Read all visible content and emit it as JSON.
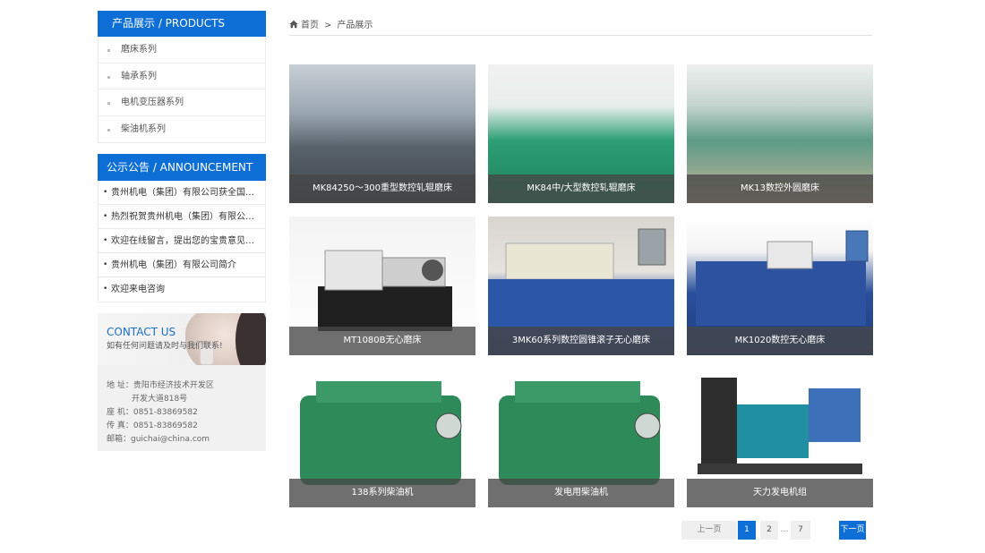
{
  "sidebar": {
    "products": {
      "title": "产品展示 / PRODUCTS",
      "items": [
        "磨床系列",
        "轴承系列",
        "电机变压器系列",
        "柴油机系列"
      ]
    },
    "announcement": {
      "title": "公示公告 / ANNOUNCEMENT",
      "items": [
        "贵州机电（集团）有限公司获全国…",
        "热烈祝贺贵州机电（集团）有限公…",
        "欢迎在线留言，提出您的宝贵意见…",
        "贵州机电（集团）有限公司简介",
        "欢迎来电咨询"
      ]
    },
    "contact": {
      "title": "CONTACT US",
      "subtitle": "如有任何问题请及时与我们联系!",
      "address_label": "地 址：",
      "address_line1": "贵阳市经济技术开发区",
      "address_line2": "开发大道818号",
      "phone_label": "座 机：",
      "phone": "0851-83869582",
      "fax_label": "传 真：",
      "fax": "0851-83869582",
      "email_label": "邮箱：",
      "email": "guichai@china.com"
    }
  },
  "breadcrumb": {
    "home": "首页",
    "separator": ">",
    "current": "产品展示"
  },
  "products": [
    {
      "caption": "MK84250～300重型数控轧辊磨床",
      "style": "ph-workshop"
    },
    {
      "caption": "MK84中/大型数控轧辊磨床",
      "style": "ph-green"
    },
    {
      "caption": "MK13数控外圆磨床",
      "style": "ph-greenlong"
    },
    {
      "caption": "MT1080B无心磨床",
      "style": "ph-white"
    },
    {
      "caption": "3MK60系列数控圆锥滚子无心磨床",
      "style": "ph-blue"
    },
    {
      "caption": "MK1020数控无心磨床",
      "style": "ph-blue2"
    },
    {
      "caption": "138系列柴油机",
      "style": "ph-engine"
    },
    {
      "caption": "发电用柴油机",
      "style": "ph-engine"
    },
    {
      "caption": "天力发电机组",
      "style": "ph-gen"
    }
  ],
  "pagination": {
    "prev": "上一页",
    "pages": [
      "1",
      "2",
      "…",
      "7"
    ],
    "current": "1",
    "next": "下一页"
  },
  "colors": {
    "accent": "#0d6fd6"
  },
  "icons": {
    "breadcrumb_home": "home-icon"
  }
}
